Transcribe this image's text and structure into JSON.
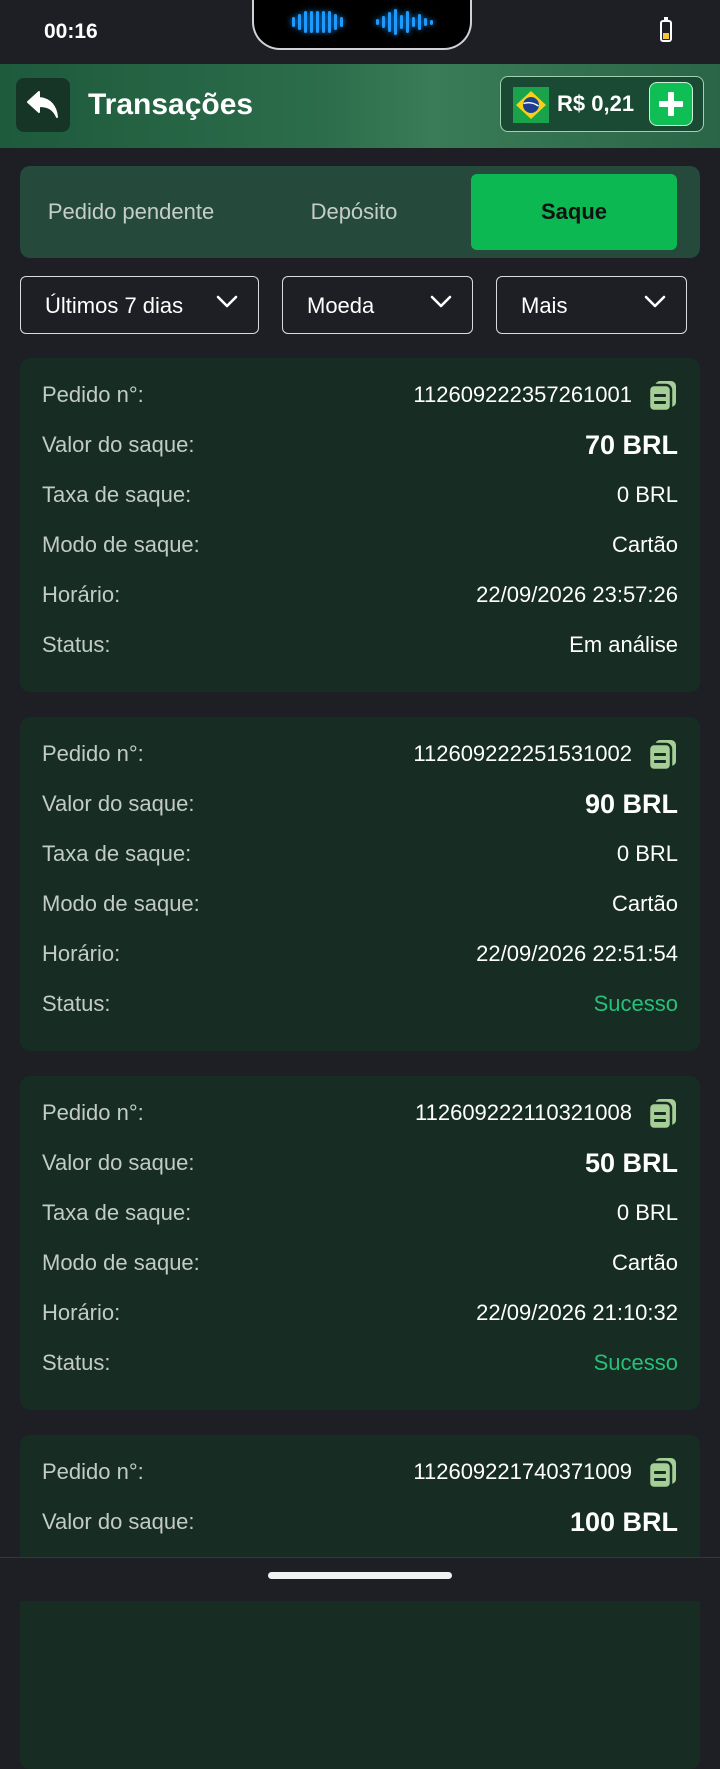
{
  "status_bar": {
    "time": "00:16"
  },
  "header": {
    "title": "Transações",
    "balance": "R$ 0,21"
  },
  "tabs": [
    {
      "label": "Pedido pendente",
      "active": false
    },
    {
      "label": "Depósito",
      "active": false
    },
    {
      "label": "Saque",
      "active": true
    }
  ],
  "filters": {
    "period": "Últimos 7 dias",
    "currency": "Moeda",
    "more": "Mais"
  },
  "field_labels": {
    "order": "Pedido n°:",
    "amount": "Valor do saque:",
    "fee": "Taxa de saque:",
    "mode": "Modo de saque:",
    "time": "Horário:",
    "status": "Status:"
  },
  "transactions": [
    {
      "order": "112609222357261001",
      "amount": "70 BRL",
      "fee": "0 BRL",
      "mode": "Cartão",
      "time": "22/09/2026 23:57:26",
      "status": "Em análise"
    },
    {
      "order": "112609222251531002",
      "amount": "90 BRL",
      "fee": "0 BRL",
      "mode": "Cartão",
      "time": "22/09/2026 22:51:54",
      "status": "Sucesso"
    },
    {
      "order": "112609222110321008",
      "amount": "50 BRL",
      "fee": "0 BRL",
      "mode": "Cartão",
      "time": "22/09/2026 21:10:32",
      "status": "Sucesso"
    },
    {
      "order": "112609221740371009",
      "amount": "100 BRL"
    }
  ],
  "colors": {
    "accent": "#0cb852",
    "success": "#27c07a",
    "card_bg": "#172c22",
    "page_bg": "#1d1f24"
  },
  "icons": {
    "back": "back-arrow-icon",
    "add": "plus-icon",
    "copy": "copy-icon",
    "dropdown": "chevron-down-icon",
    "flag": "brazil-flag-icon",
    "battery": "battery-icon"
  }
}
